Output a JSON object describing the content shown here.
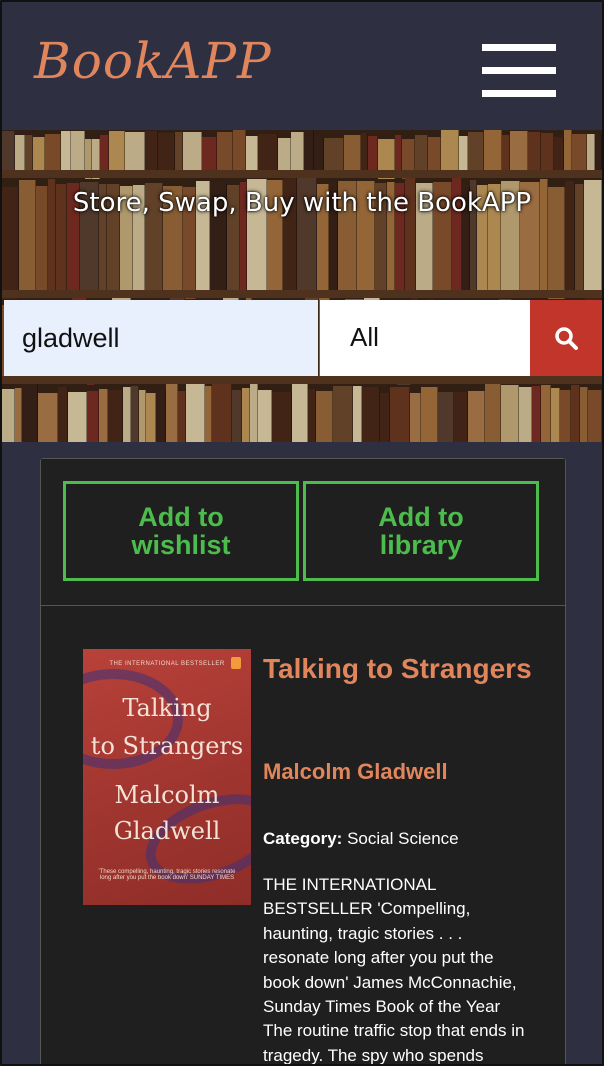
{
  "app": {
    "logo": "BookAPP"
  },
  "hero": {
    "tagline": "Store, Swap, Buy with the BookAPP"
  },
  "search": {
    "value": "gladwell",
    "category": "All"
  },
  "actions": {
    "wishlist": "Add to wishlist",
    "library": "Add to library"
  },
  "book": {
    "cover": {
      "top_text": "THE INTERNATIONAL BESTSELLER",
      "title_line1": "Talking",
      "title_line2": "to Strangers",
      "author_line1": "Malcolm",
      "author_line2": "Gladwell",
      "quote": "'These compelling, haunting, tragic stories resonate long after you put the book down' SUNDAY TIMES"
    },
    "title": "Talking to Strangers",
    "author": "Malcolm Gladwell",
    "category_label": "Category:",
    "category": "Social Science",
    "description": "THE INTERNATIONAL BESTSELLER 'Compelling, haunting, tragic stories . . . resonate long after you put the book down' James McConnachie, Sunday Times Book of the Year The routine traffic stop that ends in tragedy. The spy who spends"
  },
  "colors": {
    "accent": "#e0855c",
    "action_green": "#4cbc4c",
    "search_red": "#c1352a",
    "background": "#2e3042"
  },
  "icons": {
    "menu": "hamburger-icon",
    "search": "search-icon"
  }
}
